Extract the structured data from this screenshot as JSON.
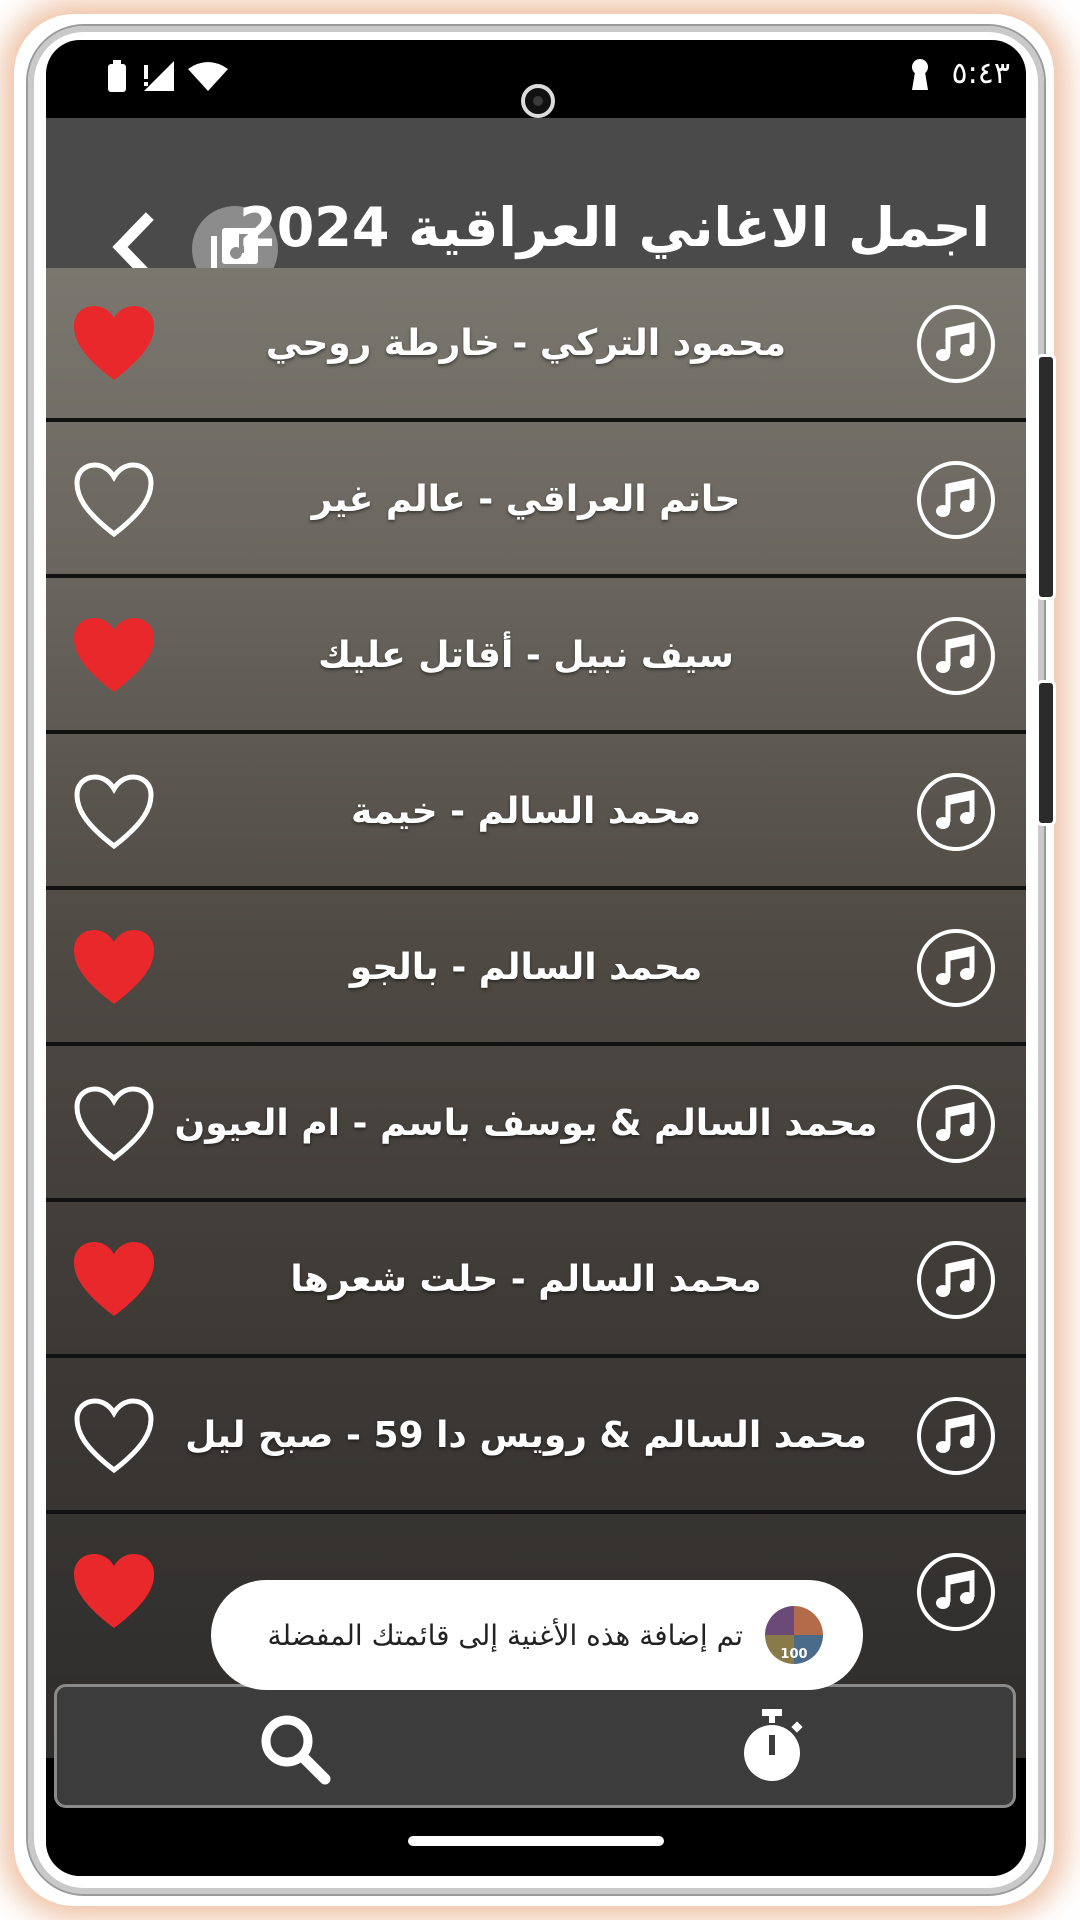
{
  "status_bar": {
    "time": "٥:٤٣"
  },
  "app_bar": {
    "title": "اجمل الاغاني العراقية 2024"
  },
  "songs": [
    {
      "title": "محمود التركي - خارطة روحي",
      "favorite": true
    },
    {
      "title": "حاتم العراقي - عالم غير",
      "favorite": false
    },
    {
      "title": "سيف نبيل - أقاتل عليك",
      "favorite": true
    },
    {
      "title": "محمد السالم - خيمة",
      "favorite": false
    },
    {
      "title": "محمد السالم - بالجو",
      "favorite": true
    },
    {
      "title": "محمد السالم & يوسف باسم - ام العيون",
      "favorite": false
    },
    {
      "title": "محمد السالم - حلت شعرها",
      "favorite": true
    },
    {
      "title": "محمد السالم & رويس دا 59 - صبح ليل",
      "favorite": false
    },
    {
      "title": "",
      "favorite": true
    }
  ],
  "toast": {
    "message": "تم إضافة هذه الأغنية إلى قائمتك المفضلة",
    "avatar_badge": "100"
  },
  "colors": {
    "heart_filled": "#e8282a",
    "app_bar": "#4a4a4a",
    "bottom_bar": "#3c3c3c"
  }
}
